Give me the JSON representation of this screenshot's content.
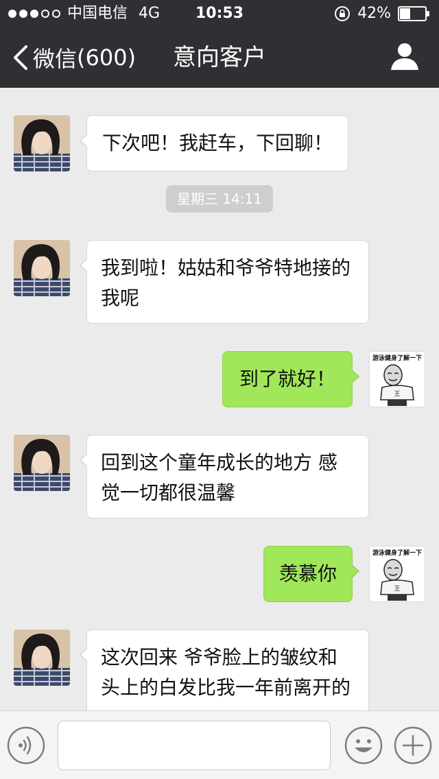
{
  "status_bar": {
    "carrier": "中国电信",
    "network": "4G",
    "time": "10:53",
    "battery_percent": "42%",
    "battery_level": 0.42
  },
  "nav": {
    "back_label": "微信",
    "back_count": "(600)",
    "title": "意向客户"
  },
  "messages": [
    {
      "side": "in",
      "text": "下次吧！我赶车，下回聊！"
    },
    {
      "side": "timestamp",
      "text": "星期三 14:11"
    },
    {
      "side": "in",
      "text": "我到啦！姑姑和爷爷特地接的我呢"
    },
    {
      "side": "out",
      "text": "到了就好！"
    },
    {
      "side": "in",
      "text": "回到这个童年成长的地方 感觉一切都很温馨"
    },
    {
      "side": "out",
      "text": "羡慕你"
    },
    {
      "side": "in",
      "text": "这次回来 爷爷脸上的皱纹和头上的白发比我一年前离开的"
    }
  ],
  "right_avatar": {
    "caption": "游泳健身了解一下",
    "badge": "王"
  },
  "input": {
    "placeholder": ""
  },
  "icons": {
    "back": "chevron-left-icon",
    "profile": "person-icon",
    "voice": "voice-icon",
    "emoji": "emoji-icon",
    "plus": "plus-icon"
  },
  "colors": {
    "nav_bg": "#2f3034",
    "chat_bg": "#ebebeb",
    "outgoing_bubble": "#a0e75a",
    "incoming_bubble": "#ffffff"
  }
}
